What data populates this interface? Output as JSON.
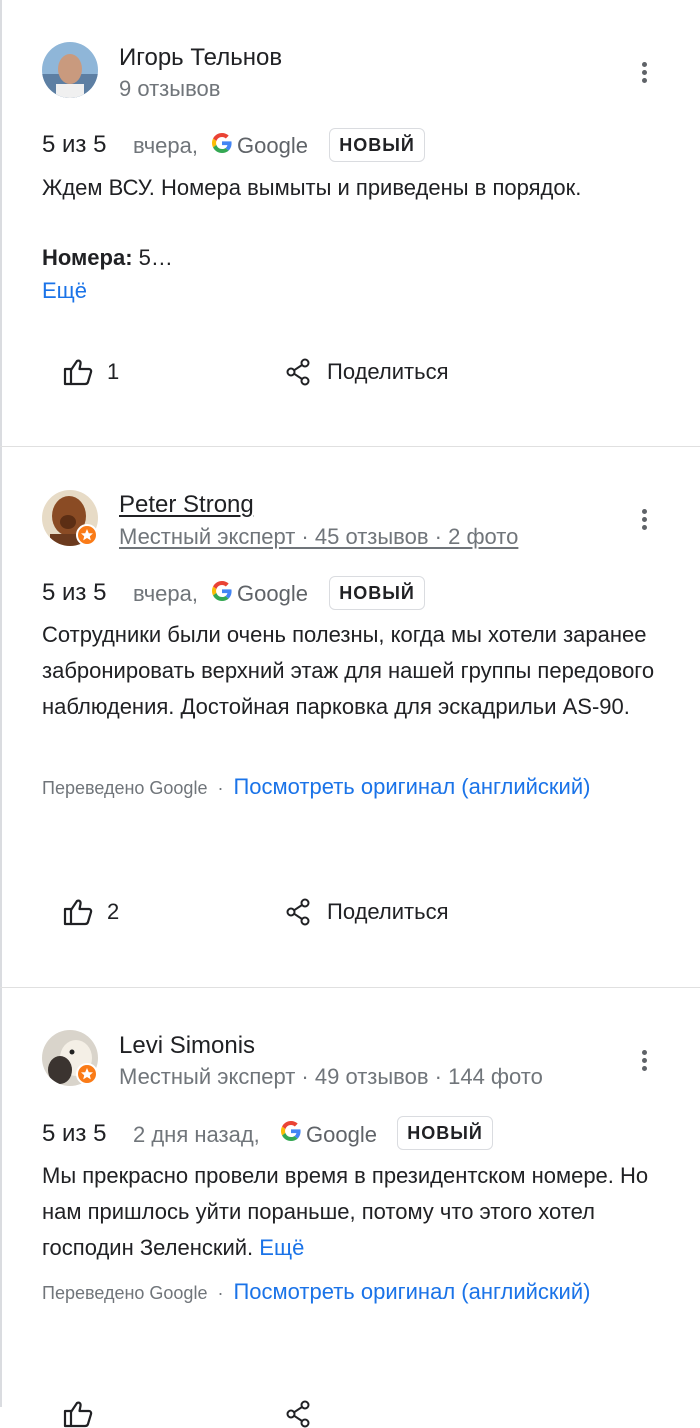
{
  "reviews": [
    {
      "author": "Игорь Тельнов",
      "meta": "9 отзывов",
      "rating": "5 из 5",
      "date": "вчера,",
      "source": "Google",
      "new_badge": "НОВЫЙ",
      "text": "Ждем ВСУ. Номера вымыты и приведены в порядок.",
      "detail_label": "Номера:",
      "detail_value": " 5…",
      "more_label": "Ещё",
      "like_count": "1",
      "share_label": "Поделиться"
    },
    {
      "author": "Peter Strong",
      "meta": "Местный эксперт · 45 отзывов · 2 фото",
      "rating": "5 из 5",
      "date": "вчера,",
      "source": "Google",
      "new_badge": "НОВЫЙ",
      "text": "Сотрудники были очень полезны, когда мы хотели заранее забронировать верхний этаж для нашей группы передового наблюдения. Достойная парковка для эскадрильи AS-90.",
      "translated_label": "Переведено Google",
      "separator": "·",
      "original_link": "Посмотреть оригинал (английский)",
      "like_count": "2",
      "share_label": "Поделиться"
    },
    {
      "author": "Levi Simonis",
      "meta": "Местный эксперт · 49 отзывов · 144 фото",
      "rating": "5 из 5",
      "date": "2 дня назад,",
      "source": "Google",
      "new_badge": "НОВЫЙ",
      "text": "Мы прекрасно провели время в президентском номере. Но нам пришлось уйти пораньше, потому что этого хотел господин Зеленский.",
      "more_label": "Ещё",
      "translated_label": "Переведено Google",
      "separator": "·",
      "original_link": "Посмотреть оригинал (английский)"
    }
  ],
  "colors": {
    "link": "#1a73e8",
    "secondary_text": "#70757a",
    "primary_text": "#202124",
    "local_guide_badge": "#fa7b17",
    "divider": "#e0e0e0"
  },
  "icons": [
    "more-vert-icon",
    "google-g-icon",
    "thumb-up-icon",
    "share-icon",
    "local-guide-badge-icon"
  ]
}
